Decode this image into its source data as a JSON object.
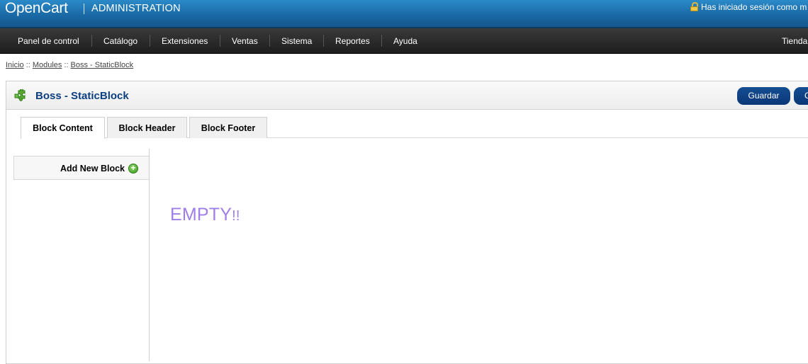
{
  "header": {
    "logo": "OpenCart",
    "title": "ADMINISTRATION",
    "login_text": "Has iniciado sesión como m",
    "login_icon": "lock-icon"
  },
  "menu": {
    "items": [
      "Panel de control",
      "Catálogo",
      "Extensiones",
      "Ventas",
      "Sistema",
      "Reportes",
      "Ayuda"
    ],
    "right_item": "Tienda"
  },
  "breadcrumb": {
    "items": [
      "Inicio",
      "Modules",
      "Boss - StaticBlock"
    ],
    "separator": "::"
  },
  "box": {
    "title": "Boss - StaticBlock",
    "title_icon": "puzzle-icon",
    "save_label": "Guardar",
    "cancel_label": "C"
  },
  "tabs": [
    {
      "label": "Block Content",
      "active": true
    },
    {
      "label": "Block Header",
      "active": false
    },
    {
      "label": "Block Footer",
      "active": false
    }
  ],
  "sidebar": {
    "add_label": "Add New Block",
    "add_icon": "add-icon"
  },
  "content": {
    "empty_text": "EMPTY",
    "empty_suffix": "!!"
  },
  "colors": {
    "header_blue": "#1a6aa6",
    "menu_dark": "#1d1d1d",
    "title_blue": "#0b3f80",
    "button_blue": "#0b3777",
    "empty_purple": "#a07ee8"
  }
}
